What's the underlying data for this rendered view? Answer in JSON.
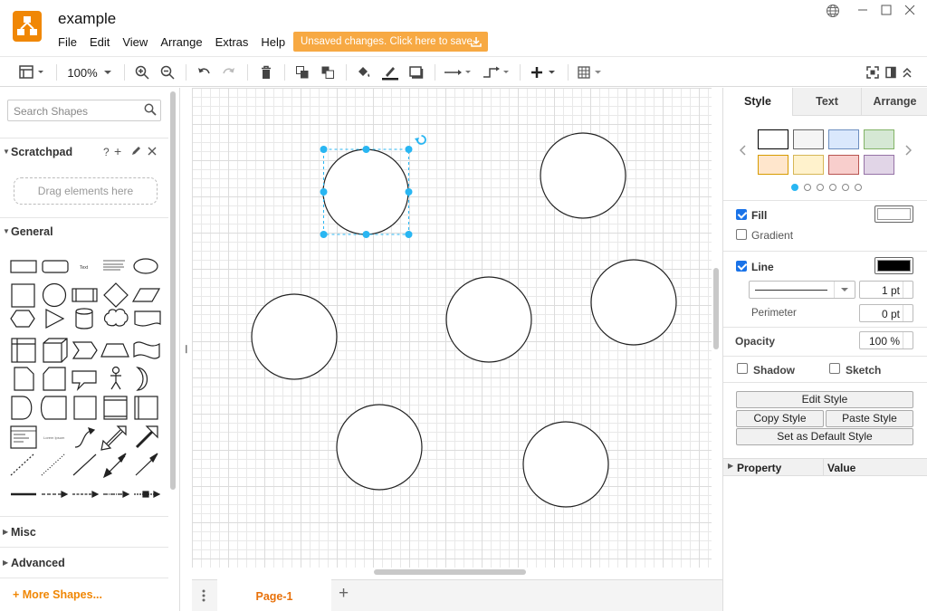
{
  "window": {
    "title": "example"
  },
  "menu": [
    "File",
    "Edit",
    "View",
    "Arrange",
    "Extras",
    "Help"
  ],
  "unsaved_label": "Unsaved changes. Click here to save.",
  "toolbar": {
    "zoom": "100%"
  },
  "left": {
    "search_placeholder": "Search Shapes",
    "scratchpad_label": "Scratchpad",
    "scratchpad_help": "?",
    "scratchpad_add": "+",
    "dropzone": "Drag elements here",
    "general_label": "General",
    "misc_label": "Misc",
    "advanced_label": "Advanced",
    "more_shapes": "+ More Shapes..."
  },
  "page_tab": "Page-1",
  "page_add": "+",
  "right": {
    "tabs": [
      "Style",
      "Text",
      "Arrange"
    ],
    "swatches": [
      "#ffffff",
      "#f5f5f5",
      "#dae8fc",
      "#d5e8d4",
      "#ffe6cc",
      "#fff2cc",
      "#f8cecc",
      "#e1d5e7"
    ],
    "swatch_borders": [
      "#000000",
      "#666666",
      "#6c8ebf",
      "#82b366",
      "#d79b00",
      "#d6b656",
      "#b85450",
      "#9673a6"
    ],
    "fill_label": "Fill",
    "gradient_label": "Gradient",
    "line_label": "Line",
    "line_width": "1 pt",
    "perimeter_label": "Perimeter",
    "perimeter_value": "0 pt",
    "opacity_label": "Opacity",
    "opacity_value": "100 %",
    "shadow_label": "Shadow",
    "sketch_label": "Sketch",
    "edit_style": "Edit Style",
    "copy_style": "Copy Style",
    "paste_style": "Paste Style",
    "default_style": "Set as Default Style",
    "prop_col": "Property",
    "value_col": "Value"
  },
  "colors": {
    "accent": "#f08705",
    "selection": "#29b6f2",
    "page_tab": "#e8710a"
  }
}
